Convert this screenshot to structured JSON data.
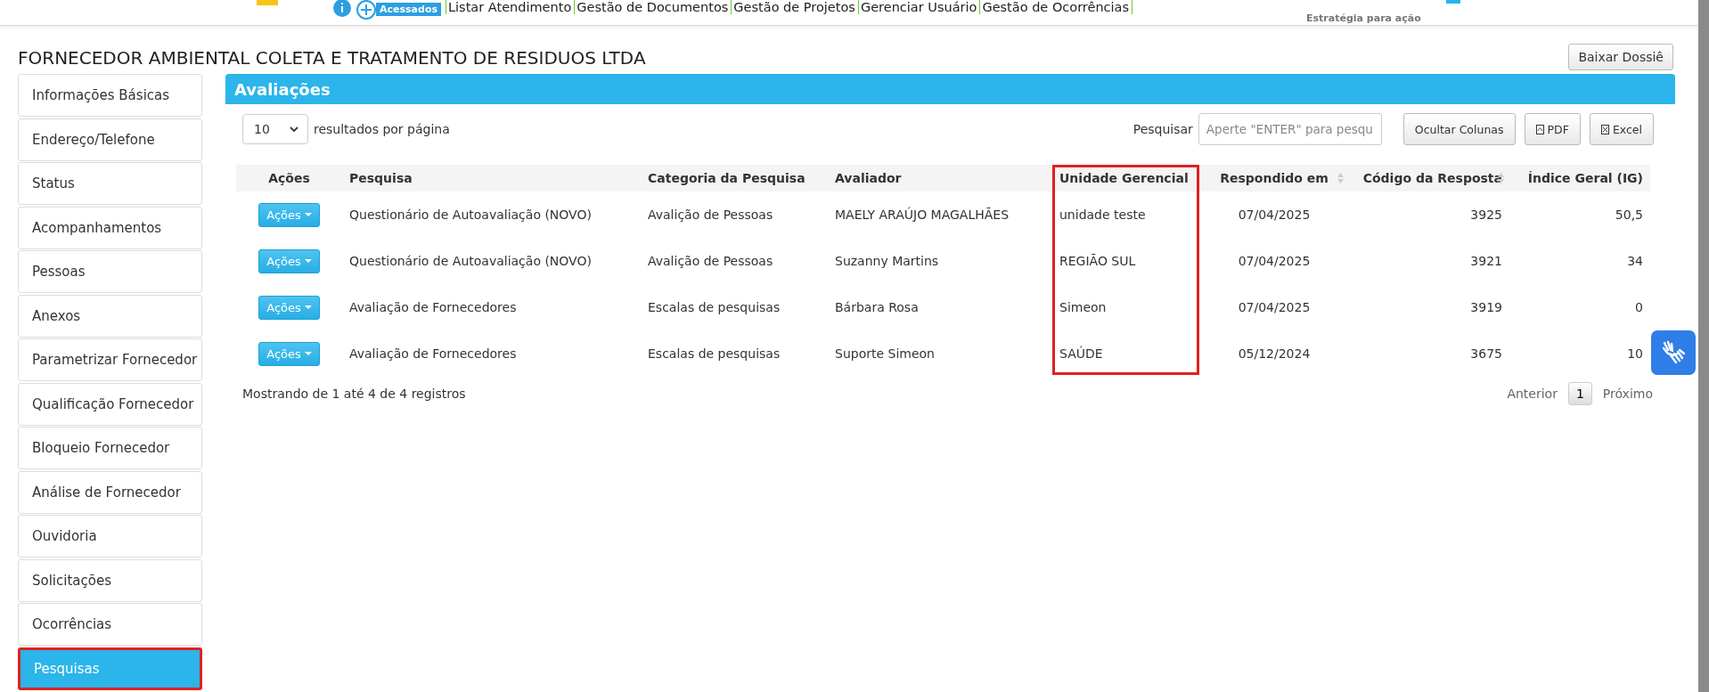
{
  "top_nav": {
    "badge": "Acessados",
    "links": [
      "Listar Atendimento",
      "Gestão de Documentos",
      "Gestão de Projetos",
      "Gerenciar Usuário",
      "Gestão de Ocorrências"
    ],
    "tagline": "Estratégia para ação"
  },
  "page_title": "FORNECEDOR AMBIENTAL COLETA E TRATAMENTO DE RESIDUOS LTDA",
  "dossier_button": "Baixar Dossiê",
  "sidebar": {
    "items": [
      {
        "label": "Informações Básicas",
        "selected": false
      },
      {
        "label": "Endereço/Telefone",
        "selected": false
      },
      {
        "label": "Status",
        "selected": false
      },
      {
        "label": "Acompanhamentos",
        "selected": false
      },
      {
        "label": "Pessoas",
        "selected": false
      },
      {
        "label": "Anexos",
        "selected": false
      },
      {
        "label": "Parametrizar Fornecedor",
        "selected": false
      },
      {
        "label": "Qualificação Fornecedor",
        "selected": false
      },
      {
        "label": "Bloqueio Fornecedor",
        "selected": false
      },
      {
        "label": "Análise de Fornecedor",
        "selected": false
      },
      {
        "label": "Ouvidoria",
        "selected": false
      },
      {
        "label": "Solicitações",
        "selected": false
      },
      {
        "label": "Ocorrências",
        "selected": false
      },
      {
        "label": "Pesquisas",
        "selected": true,
        "highlighted": true
      }
    ]
  },
  "panel": {
    "title": "Avaliações",
    "page_size": "10",
    "page_size_label": "resultados por página",
    "search_label": "Pesquisar",
    "search": {
      "placeholder": "Aperte \"ENTER\" para pesqu"
    },
    "buttons": [
      "Ocultar Colunas",
      "PDF",
      "Excel"
    ],
    "table": {
      "columns": [
        {
          "label": "Ações",
          "sortable": false
        },
        {
          "label": "Pesquisa",
          "sortable": false
        },
        {
          "label": "Categoria da Pesquisa",
          "sortable": false
        },
        {
          "label": "Avaliador",
          "sortable": false
        },
        {
          "label": "Unidade Gerencial",
          "sortable": false,
          "highlighted": true
        },
        {
          "label": "Respondido em",
          "sortable": true
        },
        {
          "label": "Código da Resposta",
          "sortable": true
        },
        {
          "label": "Índice Geral (IG)",
          "sortable": false
        }
      ],
      "rows": [
        {
          "cells": [
            "Ações",
            "Questionário de Autoavaliação (NOVO)",
            "Avalição de Pessoas",
            "MAELY ARAÚJO MAGALHÃES",
            "unidade teste",
            "07/04/2025",
            "3925",
            "50,5"
          ]
        },
        {
          "cells": [
            "Ações",
            "Questionário de Autoavaliação (NOVO)",
            "Avalição de Pessoas",
            "Suzanny Martins",
            "REGIÃO SUL",
            "07/04/2025",
            "3921",
            "34"
          ]
        },
        {
          "cells": [
            "Ações",
            "Avaliação de Fornecedores",
            "Escalas de pesquisas",
            "Bárbara Rosa",
            "Simeon",
            "07/04/2025",
            "3919",
            "0"
          ]
        },
        {
          "cells": [
            "Ações",
            "Avaliação de Fornecedores",
            "Escalas de pesquisas",
            "Suporte Simeon",
            "SAÚDE",
            "05/12/2024",
            "3675",
            "10"
          ]
        }
      ]
    },
    "info": "Mostrando de 1 até 4 de 4 registros",
    "pagination": {
      "previous": "Anterior",
      "pages": [
        {
          "label": "1",
          "selected": true
        }
      ],
      "next": "Próximo"
    }
  }
}
